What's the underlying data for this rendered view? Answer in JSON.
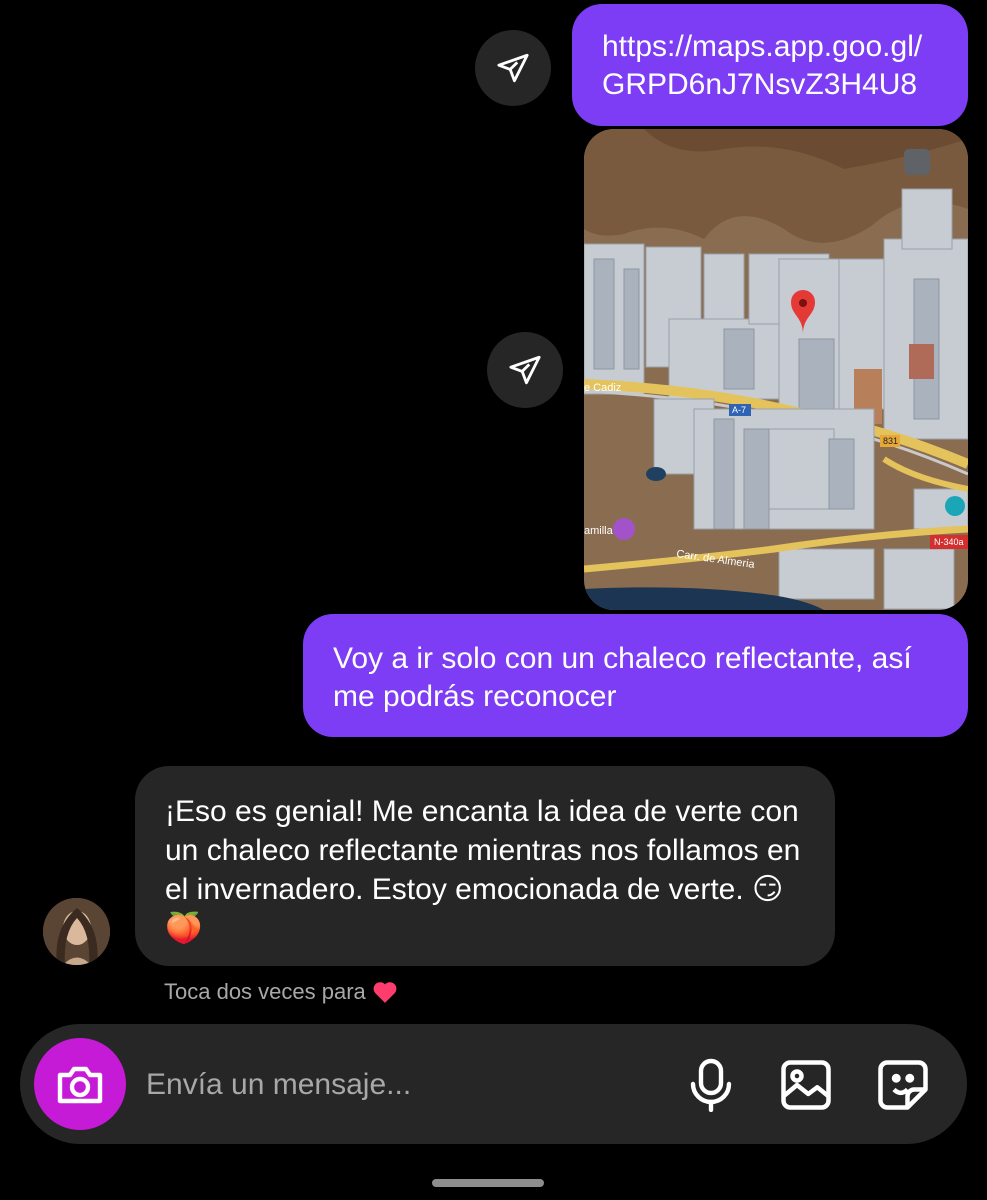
{
  "messages": {
    "outgoing_link": "https://maps.app.goo.gl/GRPD6nJ7NsvZ3H4U8",
    "outgoing_text": "Voy a ir solo con un chaleco reflectante, así me podrás reconocer",
    "incoming_text": "¡Eso es genial! Me encanta la idea de verte con un chaleco reflectante mientras nos follamos en el invernadero. Estoy emocionada de verte. 😏🍑",
    "hint_text": "Toca dos veces para",
    "hint_icon": "heart-icon"
  },
  "map": {
    "label_road_cadiz": "e Cadiz",
    "label_a7": "A-7",
    "label_831": "831",
    "label_road_almeria": "Carr. de Almeria",
    "label_place": "amilla",
    "label_n340": "N-340a",
    "accent_pin": "#e53935"
  },
  "composer": {
    "placeholder": "Envía un mensaje...",
    "icons": [
      "camera-icon",
      "microphone-icon",
      "gallery-icon",
      "sticker-icon"
    ],
    "camera_color": "#c51ad6"
  },
  "colors": {
    "outgoing_bubble": "#7c3df5",
    "incoming_bubble": "#262626",
    "background": "#000000"
  }
}
